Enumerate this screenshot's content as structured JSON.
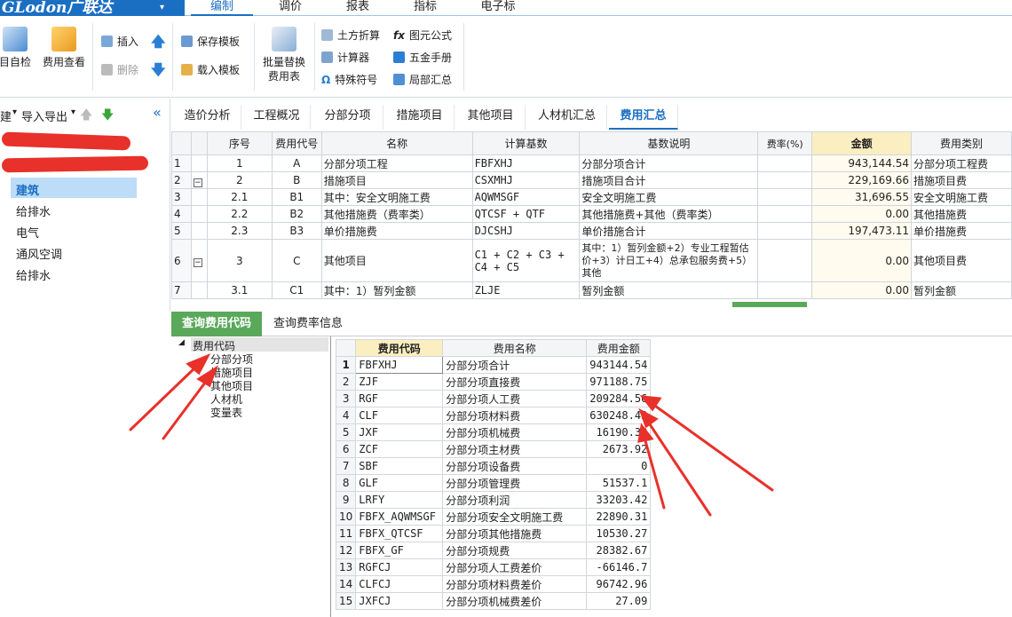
{
  "app": {
    "logo": "GLodon广联达",
    "logo_caret": "▾"
  },
  "menu": {
    "tabs": [
      "编制",
      "调价",
      "报表",
      "指标",
      "电子标"
    ],
    "active": 0
  },
  "ribbon": {
    "self_check": "目自检",
    "fee_view": "费用查看",
    "insert": "插入",
    "delete": "删除",
    "save_template": "保存模板",
    "load_template": "载入模板",
    "batch_replace": [
      "批量替换",
      "费用表"
    ],
    "earthwork": "土方折算",
    "calculator": "计算器",
    "special_symbol": "特殊符号",
    "primitive_formula": "图元公式",
    "hardware_manual": "五金手册",
    "local_summary": "局部汇总"
  },
  "leftpanel": {
    "build_btn": "建",
    "import_export": "导入导出",
    "tree": [
      "建筑",
      "给排水",
      "电气",
      "通风空调",
      "给排水"
    ],
    "selected": 0
  },
  "top_tabs": [
    "造价分析",
    "工程概况",
    "分部分项",
    "措施项目",
    "其他项目",
    "人材机汇总",
    "费用汇总"
  ],
  "top_tabs_active": 6,
  "main_grid": {
    "headers": [
      "序号",
      "费用代号",
      "名称",
      "计算基数",
      "基数说明",
      "费率(%)",
      "金额",
      "费用类别"
    ],
    "rows": [
      {
        "n": "1",
        "seq": "1",
        "code": "A",
        "name": "分部分项工程",
        "base": "FBFXHJ",
        "desc": "分部分项合计",
        "rate": "",
        "amount": "943,144.54",
        "category": "分部分项工程费"
      },
      {
        "n": "2",
        "seq": "2",
        "code": "B",
        "name": "措施项目",
        "base": "CSXMHJ",
        "desc": "措施项目合计",
        "rate": "",
        "amount": "229,169.66",
        "category": "措施项目费"
      },
      {
        "n": "3",
        "seq": "2.1",
        "code": "B1",
        "name": "其中：安全文明施工费",
        "base": "AQWMSGF",
        "desc": "安全文明施工费",
        "rate": "",
        "amount": "31,696.55",
        "category": "安全文明施工费"
      },
      {
        "n": "4",
        "seq": "2.2",
        "code": "B2",
        "name": "其他措施费（费率类）",
        "base": "QTCSF + QTF",
        "desc": "其他措施费+其他（费率类）",
        "rate": "",
        "amount": "0.00",
        "category": "其他措施费"
      },
      {
        "n": "5",
        "seq": "2.3",
        "code": "B3",
        "name": "单价措施费",
        "base": "DJCSHJ",
        "desc": "单价措施合计",
        "rate": "",
        "amount": "197,473.11",
        "category": "单价措施费"
      },
      {
        "n": "6",
        "seq": "3",
        "code": "C",
        "name": "其他项目",
        "base": "C1 + C2 + C3 + C4 + C5",
        "desc": "其中：1）暂列金额+2）专业工程暂估价+3）计日工+4）总承包服务费+5）其他",
        "rate": "",
        "amount": "0.00",
        "category": "其他项目费"
      },
      {
        "n": "7",
        "seq": "3.1",
        "code": "C1",
        "name": "其中：1）暂列金额",
        "base": "ZLJE",
        "desc": "暂列金额",
        "rate": "",
        "amount": "0.00",
        "category": "暂列金额"
      }
    ]
  },
  "bottom_tabs": [
    "查询费用代码",
    "查询费率信息"
  ],
  "bottom_tabs_active": 0,
  "code_tree": {
    "root": "费用代码",
    "children": [
      "分部分项",
      "措施项目",
      "其他项目",
      "人材机",
      "变量表"
    ]
  },
  "code_grid": {
    "headers": [
      "费用代码",
      "费用名称",
      "费用金额"
    ],
    "rows": [
      {
        "n": "1",
        "code": "FBFXHJ",
        "name": "分部分项合计",
        "amount": "943144.54"
      },
      {
        "n": "2",
        "code": "ZJF",
        "name": "分部分项直接费",
        "amount": "971188.75"
      },
      {
        "n": "3",
        "code": "RGF",
        "name": "分部分项人工费",
        "amount": "209284.56"
      },
      {
        "n": "4",
        "code": "CLF",
        "name": "分部分项材料费",
        "amount": "630248.43"
      },
      {
        "n": "5",
        "code": "JXF",
        "name": "分部分项机械费",
        "amount": "16190.33"
      },
      {
        "n": "6",
        "code": "ZCF",
        "name": "分部分项主材费",
        "amount": "2673.92"
      },
      {
        "n": "7",
        "code": "SBF",
        "name": "分部分项设备费",
        "amount": "0"
      },
      {
        "n": "8",
        "code": "GLF",
        "name": "分部分项管理费",
        "amount": "51537.1"
      },
      {
        "n": "9",
        "code": "LRFY",
        "name": "分部分项利润",
        "amount": "33203.42"
      },
      {
        "n": "10",
        "code": "FBFX_AQWMSGF",
        "name": "分部分项安全文明施工费",
        "amount": "22890.31"
      },
      {
        "n": "11",
        "code": "FBFX_QTCSF",
        "name": "分部分项其他措施费",
        "amount": "10530.27"
      },
      {
        "n": "12",
        "code": "FBFX_GF",
        "name": "分部分项规费",
        "amount": "28382.67"
      },
      {
        "n": "13",
        "code": "RGFCJ",
        "name": "分部分项人工费差价",
        "amount": "-66146.7"
      },
      {
        "n": "14",
        "code": "CLFCJ",
        "name": "分部分项材料费差价",
        "amount": "96742.96"
      },
      {
        "n": "15",
        "code": "JXFCJ",
        "name": "分部分项机械费差价",
        "amount": "27.09"
      }
    ]
  },
  "colors": {
    "brand": "#1b6fc2",
    "accent_green": "#5aa85a",
    "highlight": "#fbeec0",
    "annotation_red": "#e8312a"
  }
}
